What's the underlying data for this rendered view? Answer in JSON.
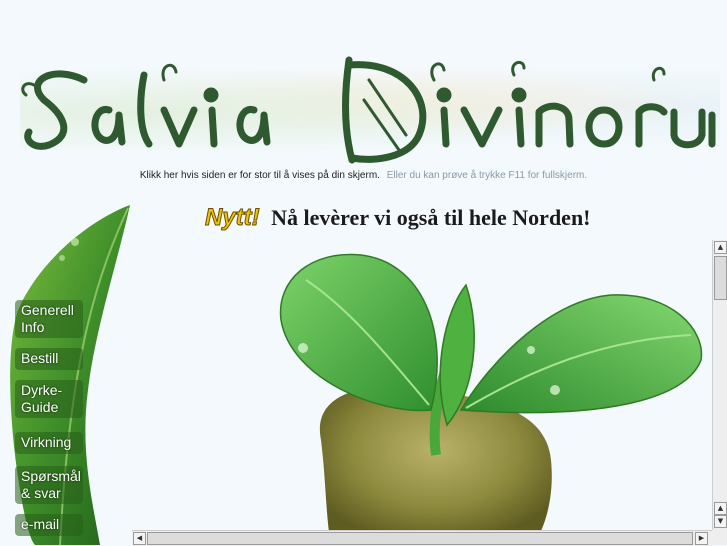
{
  "site": {
    "logo_text": "Salvia Divinorum"
  },
  "notice": {
    "link_text": "Klikk her hvis siden er for stor til å vises på din skjerm.",
    "hint_text": "Eller du kan prøve å trykke F11 for fullskjerm."
  },
  "headline": {
    "badge": "Nytt!",
    "text": "Nå levèrer vi også til hele Norden!"
  },
  "nav": {
    "items": [
      {
        "label": "Generell Info"
      },
      {
        "label": "Bestill"
      },
      {
        "label": "Dyrke-Guide"
      },
      {
        "label": "Virkning"
      },
      {
        "label": "Spørsmål & svar"
      },
      {
        "label": "e-mail"
      }
    ]
  },
  "colors": {
    "background": "#f3f9fd",
    "leaf_green": "#2f7a24",
    "logo_green": "#2f5a30",
    "badge_yellow": "#f0c400"
  },
  "icons": {
    "scroll_up": "triangle-up-icon",
    "scroll_down": "triangle-down-icon",
    "scroll_left": "triangle-left-icon",
    "scroll_right": "triangle-right-icon"
  }
}
